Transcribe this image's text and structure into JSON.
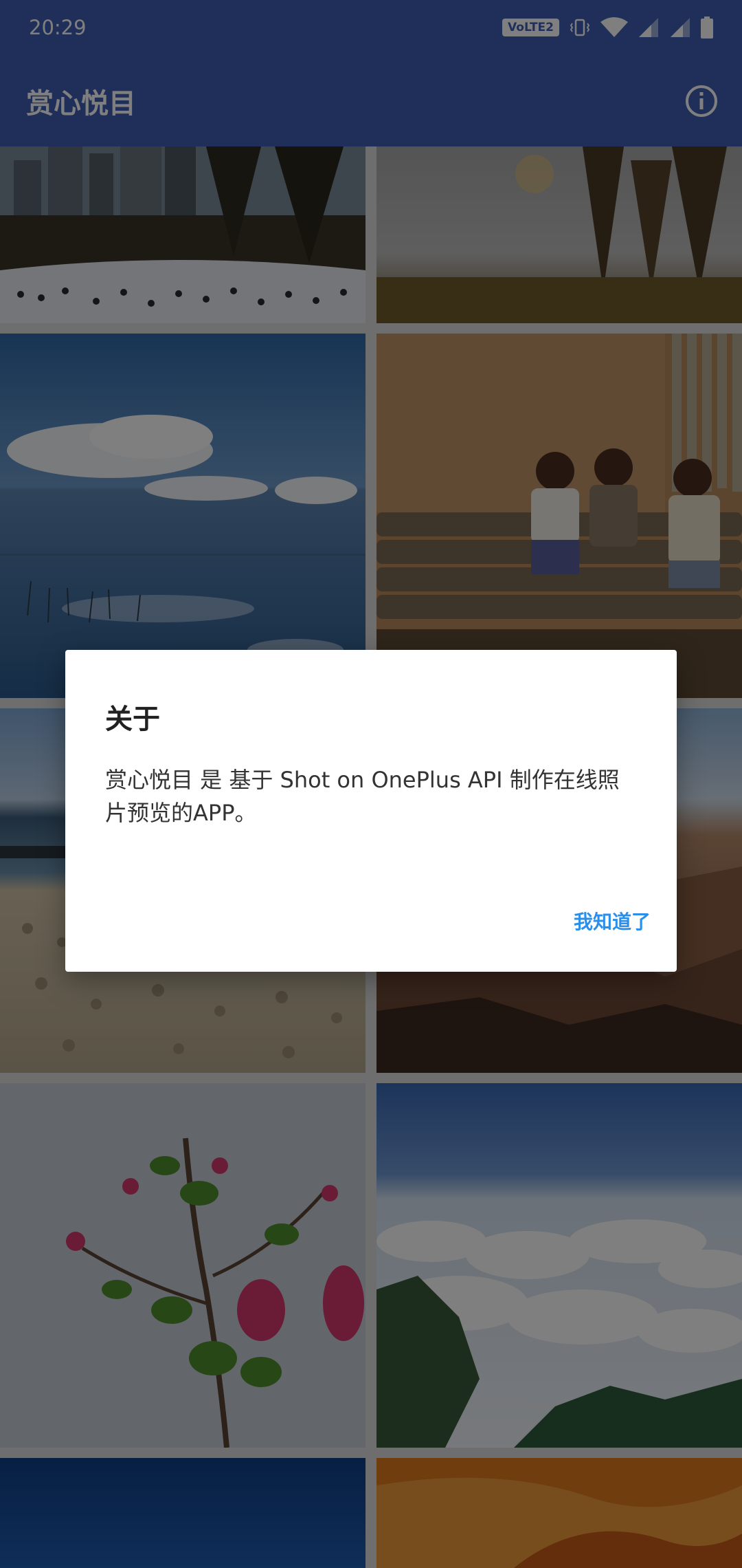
{
  "status_bar": {
    "time": "20:29",
    "volte": "VoLTE2",
    "icons": [
      "volte-icon",
      "vibrate-icon",
      "wifi-icon",
      "signal-icon",
      "signal-icon",
      "battery-icon"
    ]
  },
  "app_bar": {
    "title": "赏心悦目",
    "info_icon": "info-icon"
  },
  "gallery": {
    "tiles": [
      {
        "subject": "city-park-ice-rink"
      },
      {
        "subject": "fog-forest-sunrise"
      },
      {
        "subject": "lake-clouds-reflection"
      },
      {
        "subject": "children-sitting-on-logs"
      },
      {
        "subject": "rocky-beach-sea"
      },
      {
        "subject": "canyon-landscape"
      },
      {
        "subject": "pink-magnolia-branch"
      },
      {
        "subject": "clouds-above-mountains"
      },
      {
        "subject": "deep-blue-sky"
      },
      {
        "subject": "orange-sand-canyon"
      }
    ]
  },
  "dialog": {
    "title": "关于",
    "message": "赏心悦目 是 基于 Shot on OnePlus API 制作在线照片预览的APP。",
    "confirm_label": "我知道了"
  },
  "colors": {
    "primary": "#3e5fb4",
    "accent": "#2b8ee8",
    "scrim": "rgba(0,0,0,0.5)"
  }
}
